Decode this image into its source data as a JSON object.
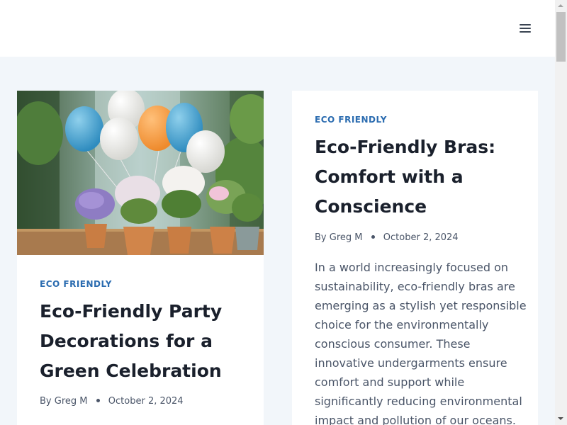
{
  "header": {
    "menu_icon": "hamburger-menu-icon"
  },
  "posts": [
    {
      "category": "ECO FRIENDLY",
      "title_lines": [
        "Eco-Friendly Party",
        "Decorations for a",
        "Green Celebration"
      ],
      "author_prefix": "By",
      "author": "Greg M",
      "date": "October 2, 2024",
      "image": "balloons-and-potted-flowers-photo"
    },
    {
      "category": "ECO FRIENDLY",
      "title_lines": [
        "Eco-Friendly Bras:",
        "Comfort with a",
        "Conscience"
      ],
      "author_prefix": "By",
      "author": "Greg M",
      "date": "October 2, 2024",
      "excerpt_lines": [
        "In a world increasingly focused on",
        "sustainability, eco-friendly bras are",
        "emerging as a stylish yet responsible",
        "choice for the environmentally",
        "conscious consumer. These",
        "innovative undergarments ensure",
        "comfort and support while",
        "significantly reducing environmental",
        "impact and pollution of our oceans."
      ]
    }
  ],
  "colors": {
    "background": "#f2f6fa",
    "card": "#ffffff",
    "category": "#2b6cb0",
    "title": "#1a202c",
    "meta": "#4a5568"
  }
}
